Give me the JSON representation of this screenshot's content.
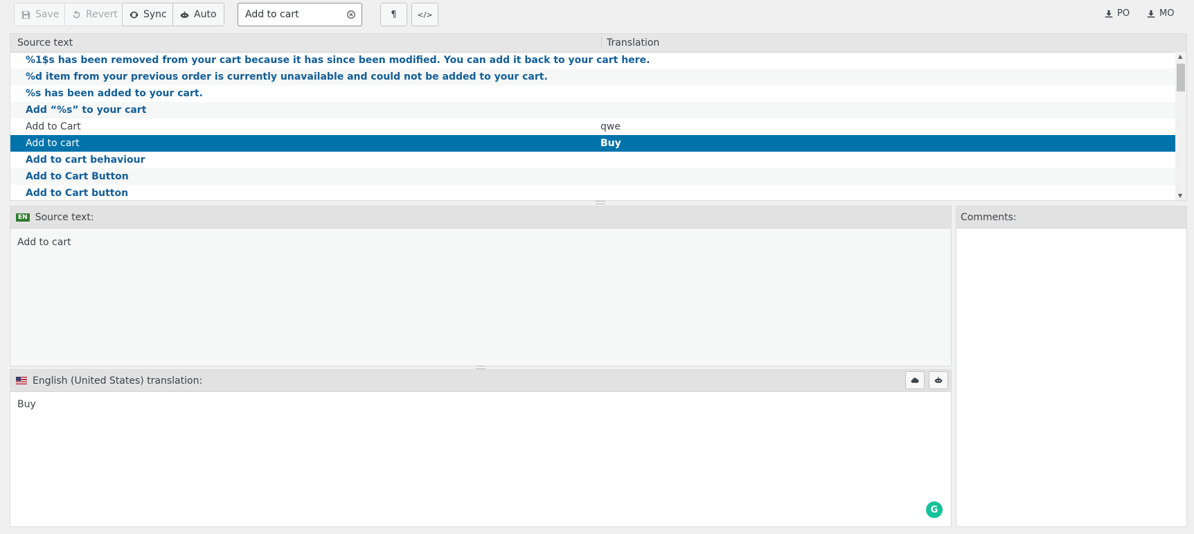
{
  "toolbar": {
    "save": "Save",
    "revert": "Revert",
    "sync": "Sync",
    "auto": "Auto",
    "search_value": "Add to cart",
    "download_po": "PO",
    "download_mo": "MO"
  },
  "grid": {
    "col_source": "Source text",
    "col_translation": "Translation",
    "rows": [
      {
        "source": "%1$s has been removed from your cart because it has since been modified. You can add it back to your cart here.",
        "translation": ""
      },
      {
        "source": "%d item from your previous order is currently unavailable and could not be added to your cart.",
        "translation": ""
      },
      {
        "source": "%s has been added to your cart.",
        "translation": ""
      },
      {
        "source": "Add “%s” to your cart",
        "translation": ""
      },
      {
        "source": "Add to Cart",
        "translation": "qwe"
      },
      {
        "source": "Add to cart",
        "translation": "Buy"
      },
      {
        "source": "Add to cart behaviour",
        "translation": ""
      },
      {
        "source": "Add to Cart Button",
        "translation": ""
      },
      {
        "source": "Add to Cart button",
        "translation": ""
      }
    ]
  },
  "source_panel": {
    "lang_badge": "EN",
    "label": "Source text:",
    "text": "Add to cart"
  },
  "translation_panel": {
    "label": "English (United States) translation:",
    "text": "Buy"
  },
  "comments_panel": {
    "label": "Comments:"
  },
  "colors": {
    "selected_row": "#0073aa",
    "untranslated_text": "#135e96",
    "grammarly": "#15c39a"
  }
}
